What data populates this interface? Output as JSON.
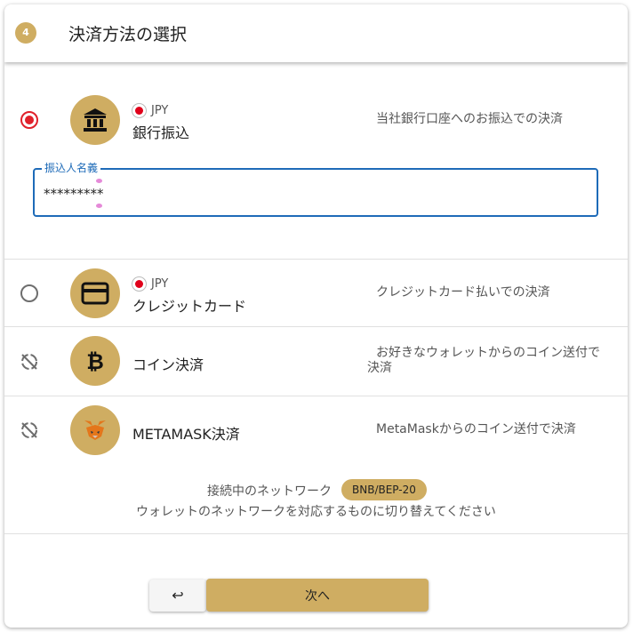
{
  "header": {
    "step": "4",
    "title": "決済方法の選択"
  },
  "methods": [
    {
      "icon": "bank-icon",
      "currency": "JPY",
      "name": "銀行振込",
      "description": "当社銀行口座へのお振込での決済",
      "selected": true
    },
    {
      "icon": "credit-card-icon",
      "currency": "JPY",
      "name": "クレジットカード",
      "description": "クレジットカード払いでの決済",
      "selected": false
    },
    {
      "icon": "bitcoin-icon",
      "name": "コイン決済",
      "description": "お好きなウォレットからのコイン送付で決済",
      "disabled": true
    },
    {
      "icon": "metamask-fox-icon",
      "name": "METAMASK決済",
      "description": "MetaMaskからのコイン送付で決済",
      "disabled": true
    }
  ],
  "payer_field": {
    "label": "振込人名義",
    "value": "*********"
  },
  "network": {
    "label": "接続中のネットワーク",
    "badge": "BNB/BEP-20",
    "note": "ウォレットのネットワークを対応するものに切り替えてください"
  },
  "buttons": {
    "back": "↩",
    "next": "次へ"
  },
  "colors": {
    "accent": "#cfad62",
    "selected_radio": "#e0202a",
    "focus_border": "#1e6bb8"
  }
}
